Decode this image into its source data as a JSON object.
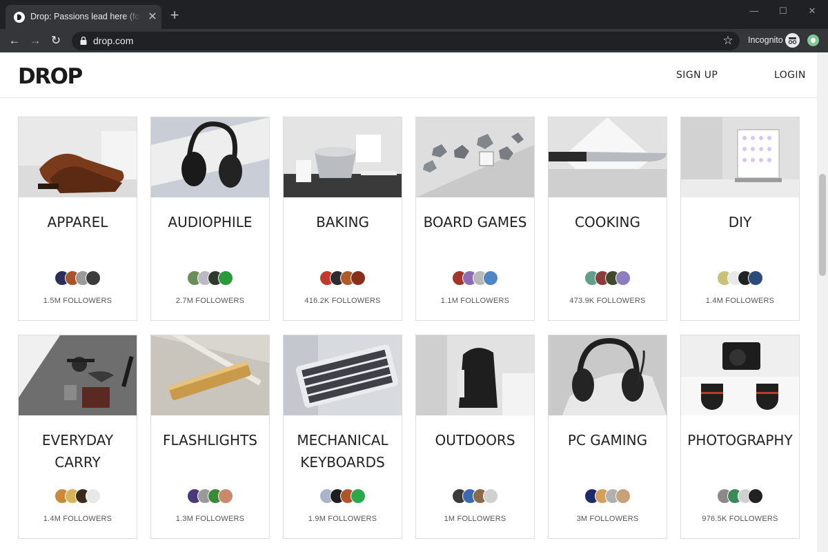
{
  "browser": {
    "tab_title": "Drop: Passions lead here (formerl",
    "tab_close_glyph": "✕",
    "new_tab_glyph": "+",
    "url": "drop.com",
    "incognito_label": "Incognito",
    "window_controls": {
      "minimize": "—",
      "maximize": "☐",
      "close": "✕"
    },
    "nav_glyphs": {
      "back": "←",
      "forward": "→",
      "reload": "↻",
      "bookmark": "☆"
    }
  },
  "header": {
    "logo_text": "DROP",
    "signup_label": "SIGN UP",
    "login_label": "LOGIN"
  },
  "communities": [
    {
      "name": "APPAREL",
      "followers": "1.5M FOLLOWERS",
      "avatar_colors": [
        "#2b2e5a",
        "#a9532a",
        "#9a9a9a",
        "#3b3b3b"
      ]
    },
    {
      "name": "AUDIOPHILE",
      "followers": "2.7M FOLLOWERS",
      "avatar_colors": [
        "#6b8d5a",
        "#bdb9c4",
        "#2e3a2c",
        "#2b9a3c"
      ]
    },
    {
      "name": "BAKING",
      "followers": "416.2K FOLLOWERS",
      "avatar_colors": [
        "#c0392b",
        "#2d2d2d",
        "#b05a2a",
        "#8a2e1c"
      ]
    },
    {
      "name": "BOARD GAMES",
      "followers": "1.1M FOLLOWERS",
      "avatar_colors": [
        "#a3362a",
        "#8d6bb5",
        "#b8b8b8",
        "#4f86c6"
      ]
    },
    {
      "name": "COOKING",
      "followers": "473.9K FOLLOWERS",
      "avatar_colors": [
        "#5da18a",
        "#8a3b3b",
        "#3f4a2d",
        "#8e7dbe"
      ]
    },
    {
      "name": "DIY",
      "followers": "1.4M FOLLOWERS",
      "avatar_colors": [
        "#c9c07a",
        "#e9e9e9",
        "#222222",
        "#2c4a7a"
      ]
    },
    {
      "name": "EVERYDAY CARRY",
      "followers": "1.4M FOLLOWERS",
      "avatar_colors": [
        "#c98a3a",
        "#d6b45a",
        "#3b2a1e",
        "#e8e8e8"
      ]
    },
    {
      "name": "FLASHLIGHTS",
      "followers": "1.3M FOLLOWERS",
      "avatar_colors": [
        "#4a3a7a",
        "#9a9a9a",
        "#3a8a3a",
        "#c98a6a"
      ]
    },
    {
      "name": "MECHANICAL KEYBOARDS",
      "followers": "1.9M FOLLOWERS",
      "avatar_colors": [
        "#aab4c8",
        "#1f1f1f",
        "#b0552a",
        "#2aa84a"
      ]
    },
    {
      "name": "OUTDOORS",
      "followers": "1M FOLLOWERS",
      "avatar_colors": [
        "#3a3a3a",
        "#3a6ab0",
        "#8a6a4a",
        "#d0d0d0"
      ]
    },
    {
      "name": "PC GAMING",
      "followers": "3M FOLLOWERS",
      "avatar_colors": [
        "#1e2a6a",
        "#d6a05a",
        "#b0b0b0",
        "#c8a07a"
      ]
    },
    {
      "name": "PHOTOGRAPHY",
      "followers": "976.5K FOLLOWERS",
      "avatar_colors": [
        "#8a8a8a",
        "#3a8a5a",
        "#d0d0d0",
        "#222222"
      ]
    }
  ]
}
